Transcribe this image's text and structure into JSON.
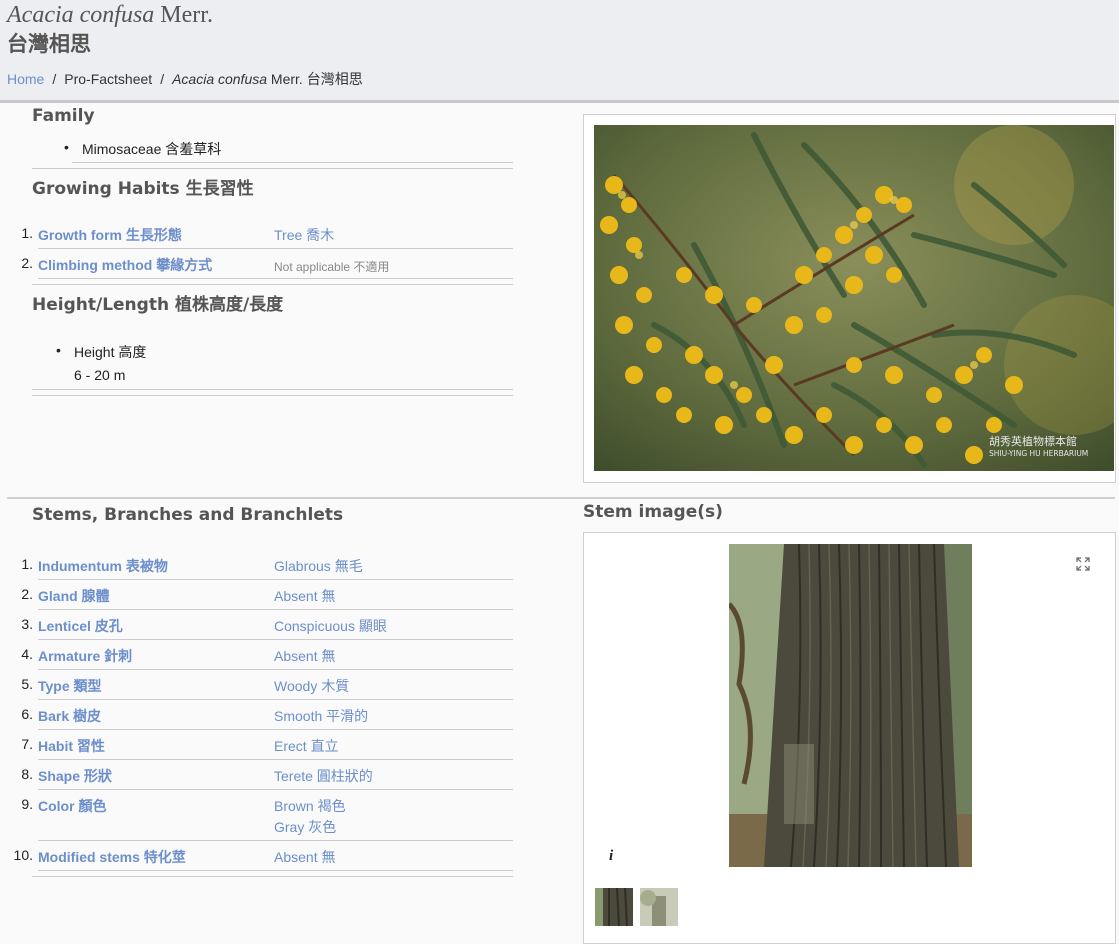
{
  "title": {
    "genus_species": "Acacia confusa",
    "author": "Merr.",
    "chinese": "台灣相思"
  },
  "breadcrumb": {
    "home": "Home",
    "section": "Pro-Factsheet",
    "species": "Acacia confusa",
    "species_rest": "Merr. 台灣相思"
  },
  "family": {
    "heading": "Family",
    "value": "Mimosaceae 含羞草科"
  },
  "growing": {
    "heading": "Growing Habits 生長習性",
    "rows": [
      {
        "num": "1.",
        "label": "Growth form 生長形態",
        "value": "Tree 喬木"
      },
      {
        "num": "2.",
        "label": "Climbing method 攀緣方式",
        "value": "Not applicable 不適用"
      }
    ]
  },
  "height": {
    "heading": "Height/Length 植株高度/長度",
    "label": "Height 高度",
    "value": "6 - 20 m"
  },
  "stems": {
    "heading": "Stems, Branches and Branchlets",
    "image_heading": "Stem image(s)",
    "info": "i",
    "rows": [
      {
        "num": "1.",
        "label": "Indumentum 表被物",
        "value": "Glabrous 無毛"
      },
      {
        "num": "2.",
        "label": "Gland 腺體",
        "value": "Absent 無"
      },
      {
        "num": "3.",
        "label": "Lenticel 皮孔",
        "value": "Conspicuous 顯眼"
      },
      {
        "num": "4.",
        "label": "Armature 針刺",
        "value": "Absent 無"
      },
      {
        "num": "5.",
        "label": "Type 類型",
        "value": "Woody 木質"
      },
      {
        "num": "6.",
        "label": "Bark 樹皮",
        "value": "Smooth 平滑的"
      },
      {
        "num": "7.",
        "label": "Habit 習性",
        "value": "Erect 直立"
      },
      {
        "num": "8.",
        "label": "Shape 形狀",
        "value": "Terete 圓柱狀的"
      },
      {
        "num": "9.",
        "label": "Color 顏色",
        "value": "Brown 褐色",
        "value2": "Gray 灰色"
      },
      {
        "num": "10.",
        "label": "Modified stems 特化莖",
        "value": "Absent 無"
      }
    ]
  },
  "watermark": {
    "cn": "胡秀英植物標本館",
    "en": "SHIU-YING HU HERBARIUM"
  },
  "colors": {
    "link": "#6c8fcc",
    "heading": "#555555",
    "header_bg": "#eceef1"
  }
}
